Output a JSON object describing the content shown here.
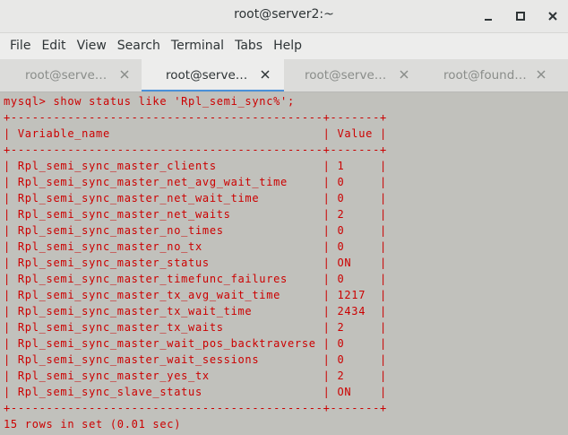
{
  "window": {
    "title": "root@server2:~",
    "controls": [
      "minimize-icon",
      "maximize-icon",
      "close-icon"
    ]
  },
  "menu": [
    "File",
    "Edit",
    "View",
    "Search",
    "Terminal",
    "Tabs",
    "Help"
  ],
  "tabs": [
    {
      "label": "root@serve…",
      "active": false
    },
    {
      "label": "root@serve…",
      "active": true
    },
    {
      "label": "root@serve…",
      "active": false
    },
    {
      "label": "root@found…",
      "active": false
    }
  ],
  "terminal": {
    "command": "mysql> show status like 'Rpl_semi_sync%';",
    "separator": "+--------------------------------------------+-------+",
    "header": [
      "Variable_name",
      "Value"
    ],
    "rows": [
      [
        "Rpl_semi_sync_master_clients",
        "1"
      ],
      [
        "Rpl_semi_sync_master_net_avg_wait_time",
        "0"
      ],
      [
        "Rpl_semi_sync_master_net_wait_time",
        "0"
      ],
      [
        "Rpl_semi_sync_master_net_waits",
        "2"
      ],
      [
        "Rpl_semi_sync_master_no_times",
        "0"
      ],
      [
        "Rpl_semi_sync_master_no_tx",
        "0"
      ],
      [
        "Rpl_semi_sync_master_status",
        "ON"
      ],
      [
        "Rpl_semi_sync_master_timefunc_failures",
        "0"
      ],
      [
        "Rpl_semi_sync_master_tx_avg_wait_time",
        "1217"
      ],
      [
        "Rpl_semi_sync_master_tx_wait_time",
        "2434"
      ],
      [
        "Rpl_semi_sync_master_tx_waits",
        "2"
      ],
      [
        "Rpl_semi_sync_master_wait_pos_backtraverse",
        "0"
      ],
      [
        "Rpl_semi_sync_master_wait_sessions",
        "0"
      ],
      [
        "Rpl_semi_sync_master_yes_tx",
        "2"
      ],
      [
        "Rpl_semi_sync_slave_status",
        "ON"
      ]
    ],
    "footer": "15 rows in set (0.01 sec)",
    "text_color": "#cc0000",
    "background": "#c1c1bc"
  }
}
